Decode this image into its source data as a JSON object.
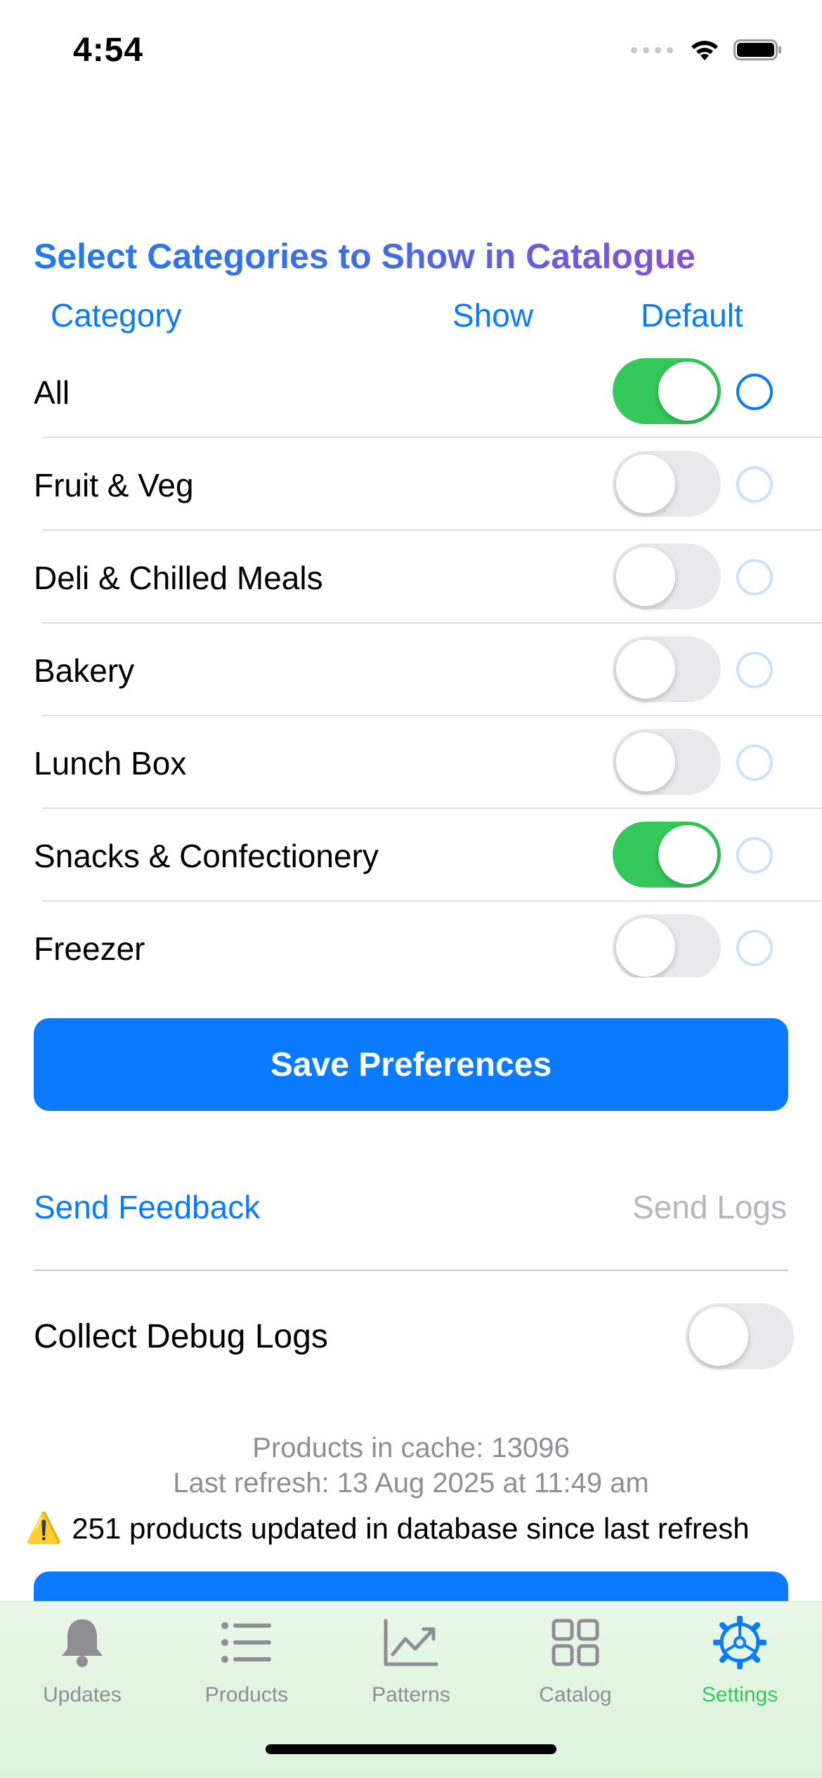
{
  "status_bar": {
    "time": "4:54"
  },
  "settings": {
    "title": "Select Categories to Show in Catalogue",
    "columns": {
      "category": "Category",
      "show": "Show",
      "default": "Default"
    },
    "categories": [
      {
        "label": "All",
        "show": true,
        "default": true
      },
      {
        "label": "Fruit & Veg",
        "show": false,
        "default": false
      },
      {
        "label": "Deli & Chilled Meals",
        "show": false,
        "default": false
      },
      {
        "label": "Bakery",
        "show": false,
        "default": false
      },
      {
        "label": "Lunch Box",
        "show": false,
        "default": false
      },
      {
        "label": "Snacks & Confectionery",
        "show": true,
        "default": false
      },
      {
        "label": "Freezer",
        "show": false,
        "default": false
      }
    ],
    "save_label": "Save Preferences",
    "feedback_label": "Send Feedback",
    "send_logs_label": "Send Logs",
    "debug_label": "Collect Debug Logs",
    "debug_enabled": false,
    "cache_text": "Products in cache: 13096",
    "refresh_text": "Last refresh: 13 Aug 2025 at 11:49 am",
    "warning_icon": "⚠️",
    "warning_text": "251 products updated in database since last refresh"
  },
  "tab_bar": {
    "tabs": [
      {
        "label": "Updates",
        "icon": "bell-icon",
        "active": false
      },
      {
        "label": "Products",
        "icon": "list-icon",
        "active": false
      },
      {
        "label": "Patterns",
        "icon": "chart-icon",
        "active": false
      },
      {
        "label": "Catalog",
        "icon": "grid-icon",
        "active": false
      },
      {
        "label": "Settings",
        "icon": "gear-icon",
        "active": true
      }
    ]
  },
  "colors": {
    "accent": "#0a7aff",
    "toggle_on": "#34c759",
    "secondary_text": "#8e8e93"
  }
}
